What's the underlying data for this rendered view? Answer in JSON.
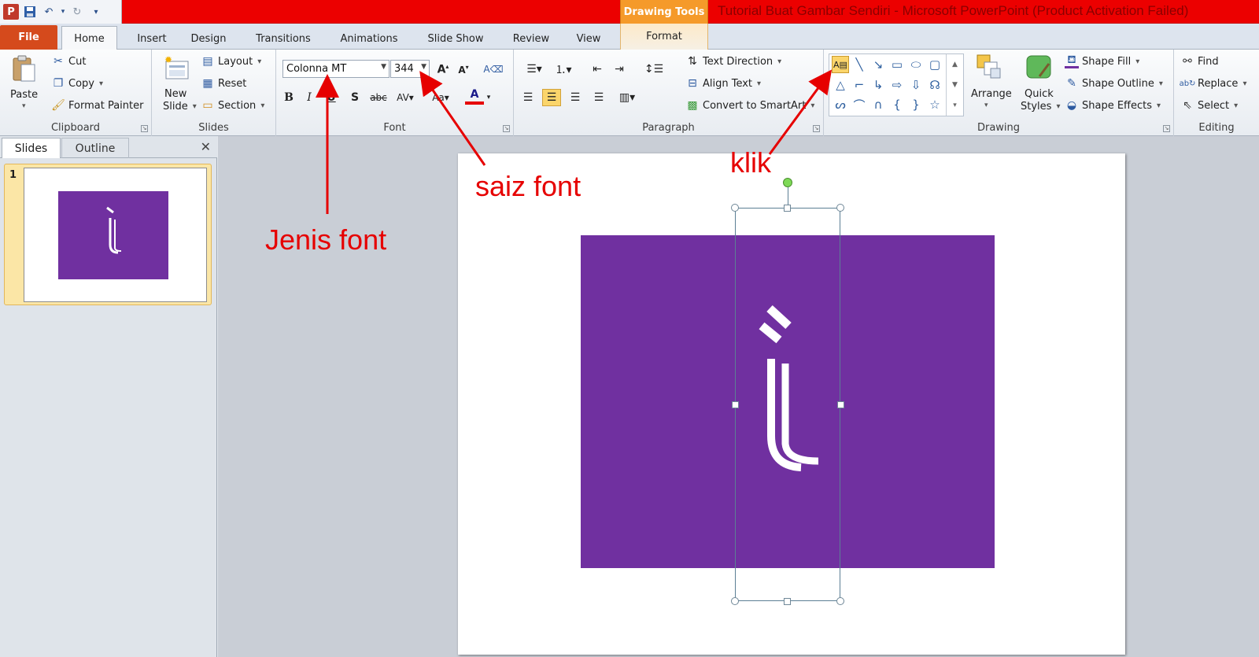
{
  "window": {
    "title": "Tutorial Buat Gambar Sendiri  -  Microsoft PowerPoint (Product Activation Failed)",
    "contextual_group": "Drawing Tools",
    "app_icon": "P"
  },
  "tabs": [
    {
      "label": "File"
    },
    {
      "label": "Home"
    },
    {
      "label": "Insert"
    },
    {
      "label": "Design"
    },
    {
      "label": "Transitions"
    },
    {
      "label": "Animations"
    },
    {
      "label": "Slide Show"
    },
    {
      "label": "Review"
    },
    {
      "label": "View"
    },
    {
      "label": "Format"
    }
  ],
  "clipboard": {
    "label": "Clipboard",
    "paste": "Paste",
    "cut": "Cut",
    "copy": "Copy",
    "format_painter": "Format Painter"
  },
  "slides_group": {
    "label": "Slides",
    "new_slide_1": "New",
    "new_slide_2": "Slide",
    "layout": "Layout",
    "reset": "Reset",
    "section": "Section"
  },
  "font": {
    "label": "Font",
    "name": "Colonna MT",
    "size": "344"
  },
  "paragraph": {
    "label": "Paragraph",
    "text_direction": "Text Direction",
    "align_text": "Align Text",
    "convert_smartart": "Convert to SmartArt"
  },
  "drawing": {
    "label": "Drawing",
    "arrange": "Arrange",
    "quick_styles_1": "Quick",
    "quick_styles_2": "Styles",
    "shape_fill": "Shape Fill",
    "shape_outline": "Shape Outline",
    "shape_effects": "Shape Effects"
  },
  "editing": {
    "label": "Editing",
    "find": "Find",
    "replace": "Replace",
    "select": "Select"
  },
  "pane": {
    "tab_slides": "Slides",
    "tab_outline": "Outline",
    "slide_number": "1"
  },
  "annotations": {
    "jenis_font": "Jenis font",
    "saiz_font": "saiz font",
    "klik": "klik"
  },
  "colors": {
    "title_bar": "#ec0000",
    "file_tab": "#d54a1c",
    "drawing_tools": "#f59a2a",
    "slide_shape": "#7030a0",
    "annotation": "#e60000"
  }
}
